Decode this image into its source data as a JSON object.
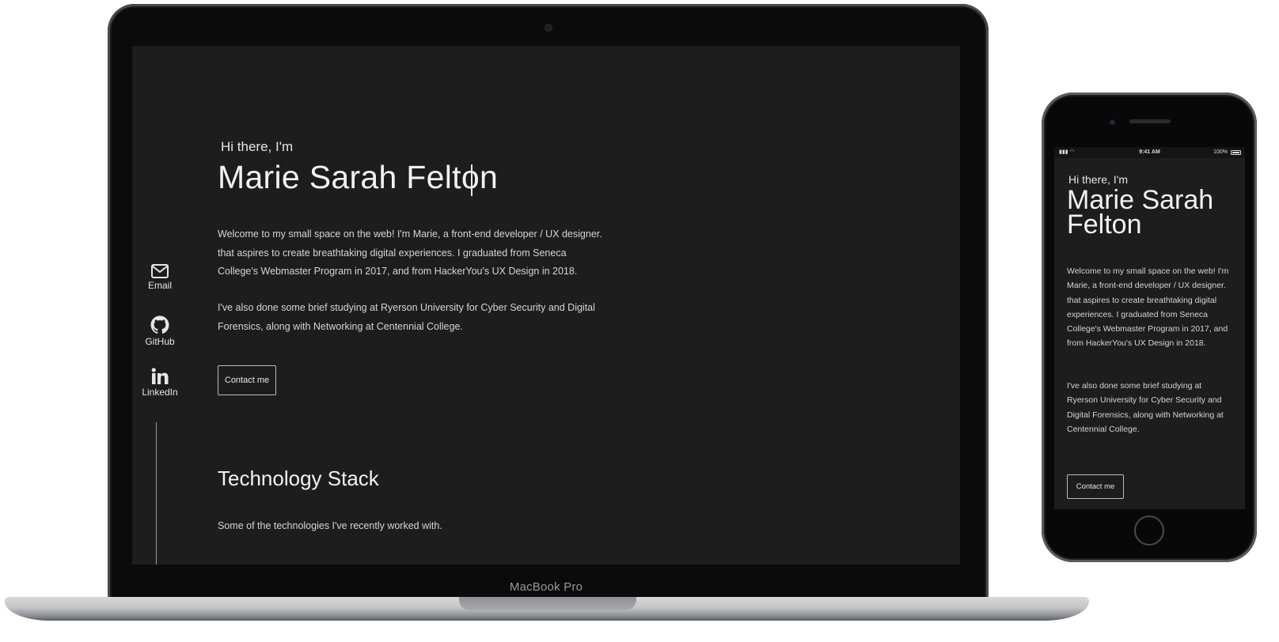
{
  "laptop": {
    "model_label": "MacBook Pro",
    "page": {
      "greeting": "Hi there, I'm",
      "name": "Marie Sarah Felton",
      "intro_paragraph": "Welcome to my small space on the web! I'm Marie, a front-end developer / UX designer. that aspires to create breathtaking digital experiences. I graduated from Seneca College's Webmaster Program in 2017, and from HackerYou's UX Design in 2018.",
      "study_paragraph": "I've also done some brief studying at Ryerson University for Cyber Security and Digital Forensics, along with Networking at Centennial College.",
      "contact_button": "Contact me",
      "social": [
        {
          "label": "Email",
          "icon": "envelope-icon"
        },
        {
          "label": "GitHub",
          "icon": "github-icon"
        },
        {
          "label": "LinkedIn",
          "icon": "linkedin-icon"
        }
      ],
      "tech_heading": "Technology Stack",
      "tech_subtext": "Some of the technologies I've recently worked with."
    }
  },
  "phone": {
    "status_bar": {
      "time": "9:41 AM",
      "battery": "100%"
    },
    "page": {
      "greeting": "Hi there, I'm",
      "name": "Marie Sarah Felton",
      "intro_paragraph": "Welcome to my small space on the web! I'm Marie, a front-end developer / UX designer. that aspires to create breathtaking digital experiences. I graduated from Seneca College's Webmaster Program in 2017, and from HackerYou's UX Design in 2018.",
      "study_paragraph": "I've also done some brief studying at Ryerson University for Cyber Security and Digital Forensics, along with Networking at Centennial College.",
      "contact_button": "Contact me"
    }
  },
  "colors": {
    "page_background": "#1d1d1d",
    "text": "#e6e6e6",
    "device_frame": "#0b0b0b"
  }
}
